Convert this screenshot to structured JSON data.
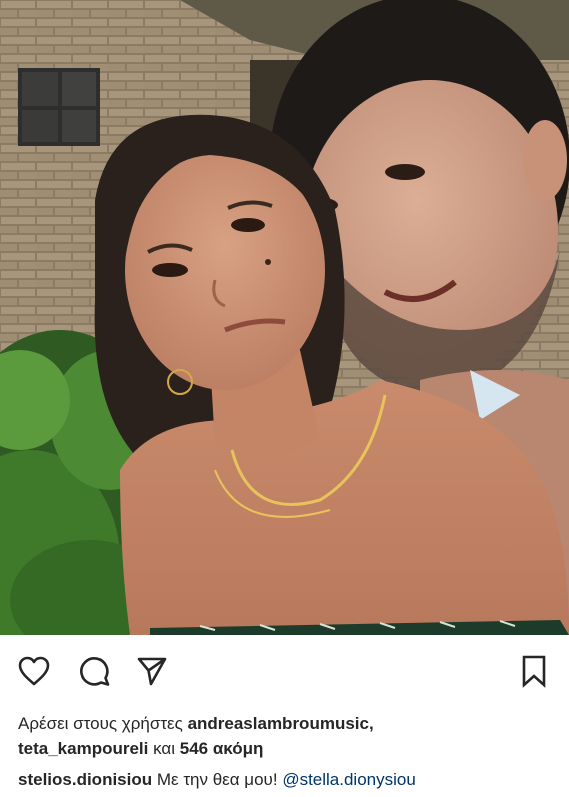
{
  "post": {
    "photo_alt": "",
    "likes": {
      "prefix": "Αρέσει στους χρήστες",
      "user1": "andreaslambroumusic,",
      "user2": "teta_kampoureli",
      "conj": "και",
      "others": "546 ακόμη"
    },
    "caption": {
      "username": "stelios.dionisiou",
      "text": "Με την θεα μου!",
      "mention": "@stella.dionysiou"
    }
  },
  "actions": {
    "like_icon": "heart-outline-icon",
    "comment_icon": "comment-bubble-icon",
    "share_icon": "paper-plane-icon",
    "save_icon": "bookmark-outline-icon"
  },
  "colors": {
    "text": "#262626",
    "mention": "#003569",
    "background": "#ffffff"
  }
}
